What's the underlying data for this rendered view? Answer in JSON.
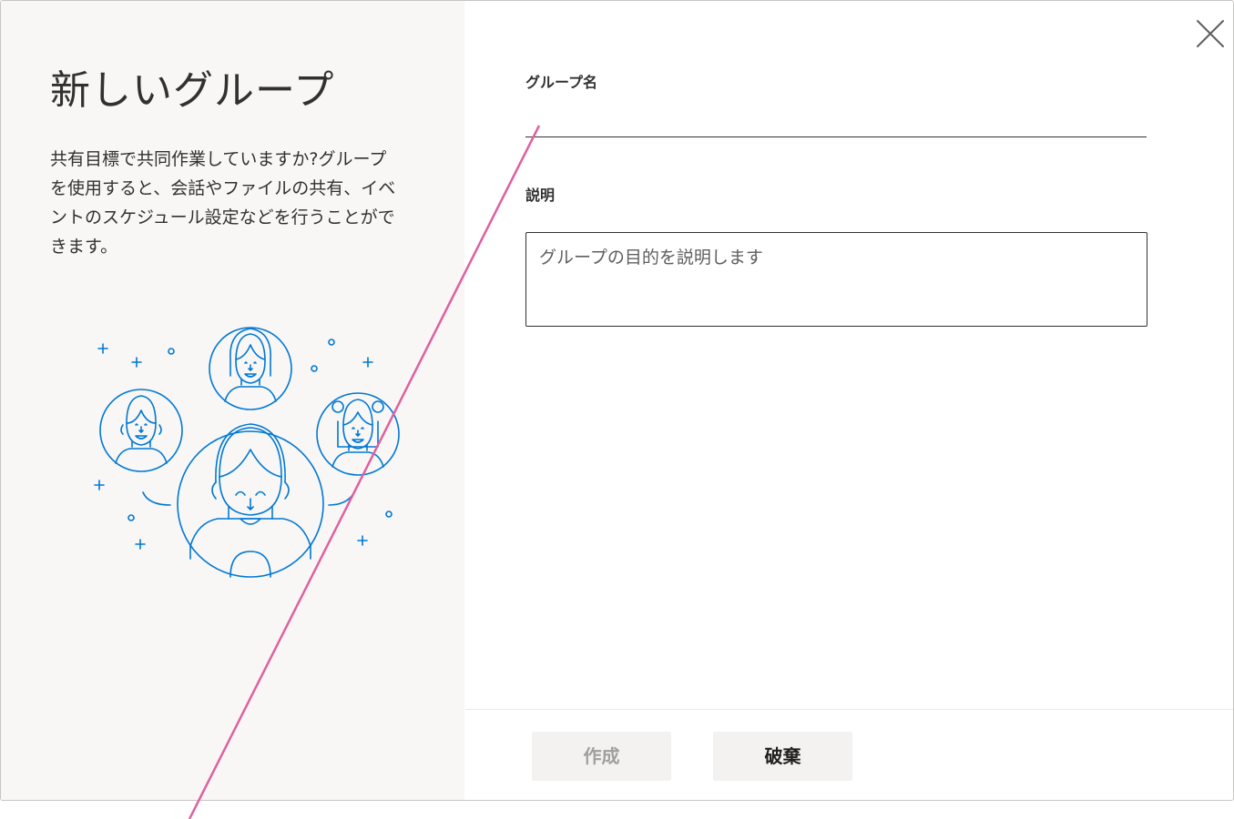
{
  "dialog": {
    "title": "新しいグループ",
    "description": "共有目標で共同作業していますか?グループを使用すると、会話やファイルの共有、イベントのスケジュール設定などを行うことができます。",
    "illustration_icon": "people-group-illustration",
    "close_icon": "close-icon"
  },
  "form": {
    "group_name_label": "グループ名",
    "group_name_value": "",
    "description_label": "説明",
    "description_placeholder": "グループの目的を説明します",
    "description_value": ""
  },
  "footer": {
    "create_label": "作成",
    "discard_label": "破棄"
  },
  "colors": {
    "left_panel_bg": "#f8f7f6",
    "illustration_stroke": "#0078d4",
    "disabled_text": "#a19f9d",
    "overlay_line": "#e0609f"
  }
}
